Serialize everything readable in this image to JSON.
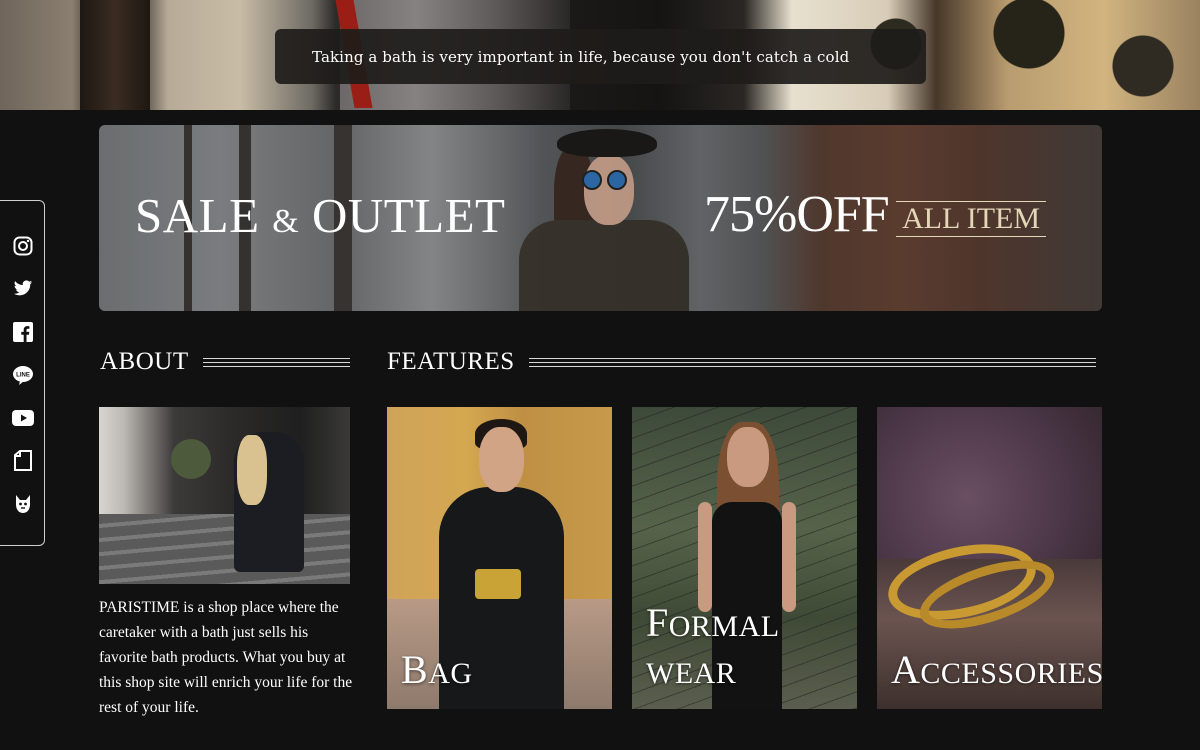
{
  "hero": {
    "quote": "Taking a bath is very important in life, because you don't catch a cold"
  },
  "banner": {
    "sale_text": "SALE",
    "amp_text": "&",
    "outlet_text": "OUTLET",
    "discount_text": "75%OFF",
    "all_item_text": "ALL ITEM"
  },
  "social": {
    "icons": [
      "instagram-icon",
      "twitter-icon",
      "facebook-icon",
      "line-icon",
      "youtube-icon",
      "note-icon",
      "mascot-icon"
    ]
  },
  "about": {
    "heading": "ABOUT",
    "text": "PARISTIME is a shop place where the caretaker with a bath just sells his favorite bath products. What you buy at this shop site will enrich your life for the rest of your life."
  },
  "features": {
    "heading": "FEATURES",
    "items": [
      {
        "label_first": "B",
        "label_rest": "AG"
      },
      {
        "label_first": "F",
        "label_rest": "ORMAL WEAR"
      },
      {
        "label_first": "A",
        "label_rest": "CCESSORIES"
      }
    ]
  },
  "colors": {
    "background": "#111111",
    "text": "#ffffff",
    "accent_gold": "#e3d7b8",
    "border": "#cfcfcf"
  }
}
